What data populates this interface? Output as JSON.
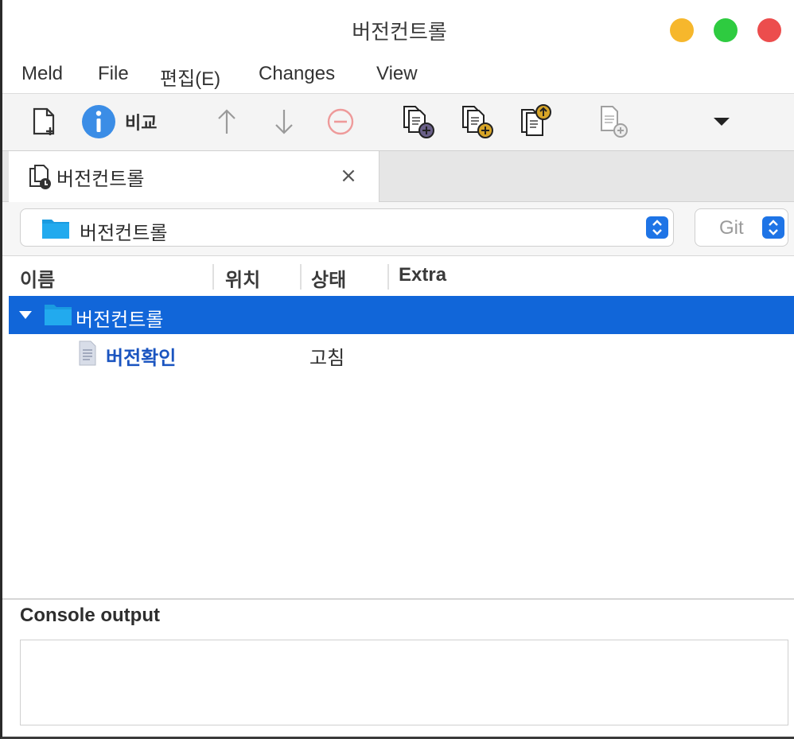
{
  "window": {
    "title": "버전컨트롤",
    "colors": {
      "minimize": "#f6b72c",
      "maximize": "#2ecb40",
      "close": "#ec4d4d",
      "selection": "#1166d9",
      "modified_text": "#1a54c0"
    }
  },
  "menubar": {
    "items": [
      "Meld",
      "File",
      "편집(E)",
      "Changes",
      "View"
    ]
  },
  "toolbar": {
    "compare_label": "비교",
    "icons": [
      "new-comparison-icon",
      "info-icon",
      "arrow-up-icon",
      "arrow-down-icon",
      "no-entry-icon",
      "copy-left-icon",
      "copy-right-icon",
      "commit-icon",
      "add-file-icon",
      "dropdown-arrow-icon"
    ]
  },
  "tabs": [
    {
      "label": "버전컨트롤",
      "close": "×"
    }
  ],
  "location": {
    "path": "버전컨트롤",
    "vcs": "Git"
  },
  "tree": {
    "columns": [
      "이름",
      "위치",
      "상태",
      "Extra"
    ],
    "rows": [
      {
        "name": "버전컨트롤",
        "location": "",
        "status": "",
        "extra": "",
        "type": "folder",
        "expanded": true,
        "selected": true
      },
      {
        "name": "버전확인",
        "location": "",
        "status": "고침",
        "extra": "",
        "type": "file",
        "state": "modified",
        "selected": false
      }
    ]
  },
  "console": {
    "title": "Console output",
    "text": ""
  }
}
